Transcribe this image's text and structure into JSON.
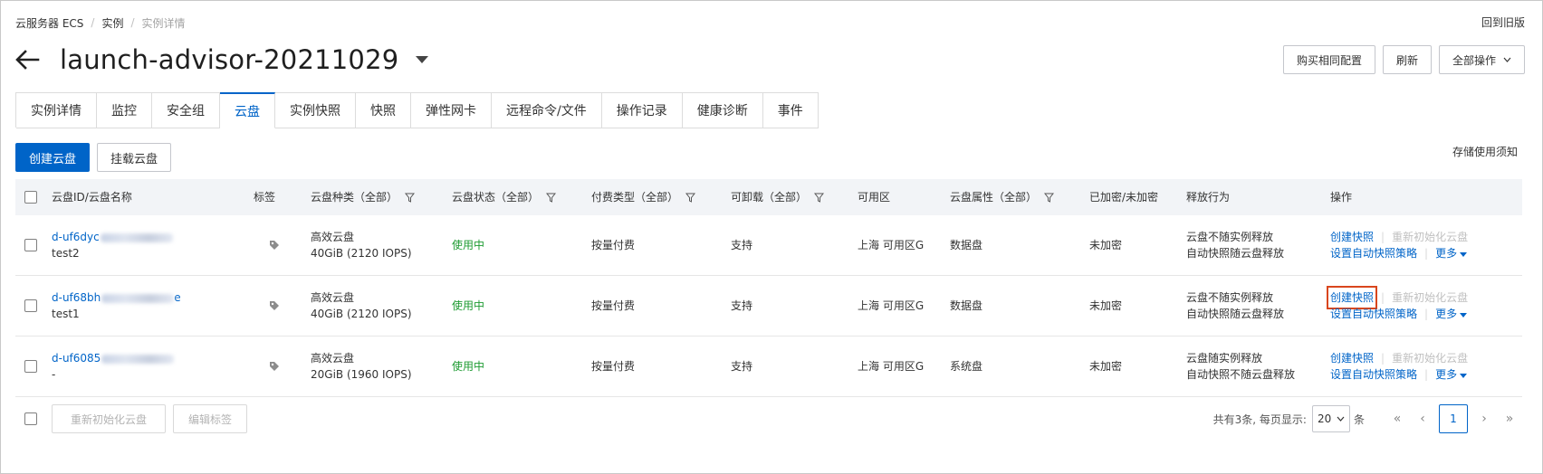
{
  "breadcrumb": {
    "items": [
      "云服务器 ECS",
      "实例",
      "实例详情"
    ],
    "back_to_old": "回到旧版"
  },
  "header": {
    "title": "launch-advisor-20211029",
    "buttons": {
      "buy_same": "购买相同配置",
      "refresh": "刷新",
      "all_actions": "全部操作"
    }
  },
  "tabs": [
    {
      "label": "实例详情"
    },
    {
      "label": "监控"
    },
    {
      "label": "安全组"
    },
    {
      "label": "云盘"
    },
    {
      "label": "实例快照"
    },
    {
      "label": "快照"
    },
    {
      "label": "弹性网卡"
    },
    {
      "label": "远程命令/文件"
    },
    {
      "label": "操作记录"
    },
    {
      "label": "健康诊断"
    },
    {
      "label": "事件"
    }
  ],
  "active_tab": "云盘",
  "actions": {
    "create_disk": "创建云盘",
    "mount_disk": "挂载云盘",
    "storage_notice": "存储使用须知"
  },
  "table": {
    "headers": {
      "id_name": "云盘ID/云盘名称",
      "tag": "标签",
      "type": "云盘种类（全部）",
      "status": "云盘状态（全部）",
      "billing": "付费类型（全部）",
      "detachable": "可卸载（全部）",
      "zone": "可用区",
      "attr": "云盘属性（全部）",
      "encrypted": "已加密/未加密",
      "release": "释放行为",
      "ops": "操作"
    },
    "rows": [
      {
        "id": "d-uf6dyc",
        "name": "test2",
        "type": "高效云盘",
        "spec": "40GiB (2120 IOPS)",
        "status": "使用中",
        "billing": "按量付费",
        "detachable": "支持",
        "zone": "上海 可用区G",
        "attr": "数据盘",
        "encrypted": "未加密",
        "release1": "云盘不随实例释放",
        "release2": "自动快照随云盘释放",
        "op_snapshot": "创建快照",
        "op_reinit": "重新初始化云盘",
        "op_policy": "设置自动快照策略",
        "op_more": "更多"
      },
      {
        "id": "d-uf68bh",
        "id_suffix": "e",
        "name": "test1",
        "type": "高效云盘",
        "spec": "40GiB (2120 IOPS)",
        "status": "使用中",
        "billing": "按量付费",
        "detachable": "支持",
        "zone": "上海 可用区G",
        "attr": "数据盘",
        "encrypted": "未加密",
        "release1": "云盘不随实例释放",
        "release2": "自动快照随云盘释放",
        "op_snapshot": "创建快照",
        "op_reinit": "重新初始化云盘",
        "op_policy": "设置自动快照策略",
        "op_more": "更多"
      },
      {
        "id": "d-uf6085",
        "name": "-",
        "type": "高效云盘",
        "spec": "20GiB (1960 IOPS)",
        "status": "使用中",
        "billing": "按量付费",
        "detachable": "支持",
        "zone": "上海 可用区G",
        "attr": "系统盘",
        "encrypted": "未加密",
        "release1": "云盘随实例释放",
        "release2": "自动快照不随云盘释放",
        "op_snapshot": "创建快照",
        "op_reinit": "重新初始化云盘",
        "op_policy": "设置自动快照策略",
        "op_more": "更多"
      }
    ]
  },
  "footer": {
    "reinit_button": "重新初始化云盘",
    "edit_tags_button": "编辑标签",
    "total_text": "共有3条, 每页显示:",
    "page_size": "20",
    "unit": "条",
    "first": "«",
    "prev": "‹",
    "current_page": "1",
    "next": "›",
    "last": "»"
  },
  "colors": {
    "primary": "#0064c8",
    "status_ok": "#1e9b32",
    "highlight": "#d9461d",
    "header_bg": "#f2f4f7"
  }
}
